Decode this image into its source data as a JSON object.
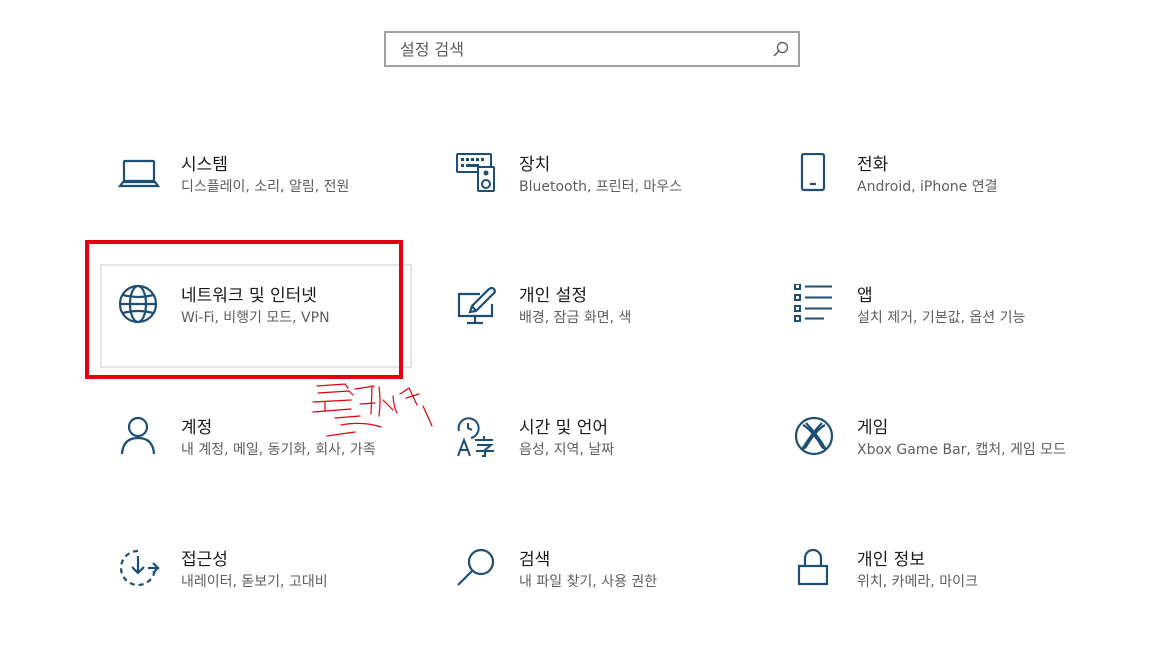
{
  "search": {
    "placeholder": "설정 검색"
  },
  "tiles": [
    {
      "title": "시스템",
      "desc": "디스플레이, 소리, 알림, 전원",
      "icon": "laptop-icon"
    },
    {
      "title": "장치",
      "desc": "Bluetooth, 프린터, 마우스",
      "icon": "devices-icon"
    },
    {
      "title": "전화",
      "desc": "Android, iPhone 연결",
      "icon": "phone-icon"
    },
    {
      "title": "네트워크 및 인터넷",
      "desc": "Wi-Fi, 비행기 모드, VPN",
      "icon": "globe-icon"
    },
    {
      "title": "개인 설정",
      "desc": "배경, 잠금 화면, 색",
      "icon": "personalization-icon"
    },
    {
      "title": "앱",
      "desc": "설치 제거, 기본값, 옵션 기능",
      "icon": "apps-list-icon"
    },
    {
      "title": "계정",
      "desc": "내 계정, 메일, 동기화, 회사, 가족",
      "icon": "person-icon"
    },
    {
      "title": "시간 및 언어",
      "desc": "음성, 지역, 날짜",
      "icon": "time-language-icon"
    },
    {
      "title": "게임",
      "desc": "Xbox Game Bar, 캡처, 게임 모드",
      "icon": "xbox-icon"
    },
    {
      "title": "접근성",
      "desc": "내레이터, 돋보기, 고대비",
      "icon": "accessibility-icon"
    },
    {
      "title": "검색",
      "desc": "내 파일 찾기, 사용 권한",
      "icon": "search-magnifier-icon"
    },
    {
      "title": "개인 정보",
      "desc": "위치, 카메라, 마이크",
      "icon": "lock-icon"
    }
  ],
  "colors": {
    "icon": "#1d4f76",
    "annotation": "#e3000f",
    "hover_border": "#e6e6e6"
  }
}
